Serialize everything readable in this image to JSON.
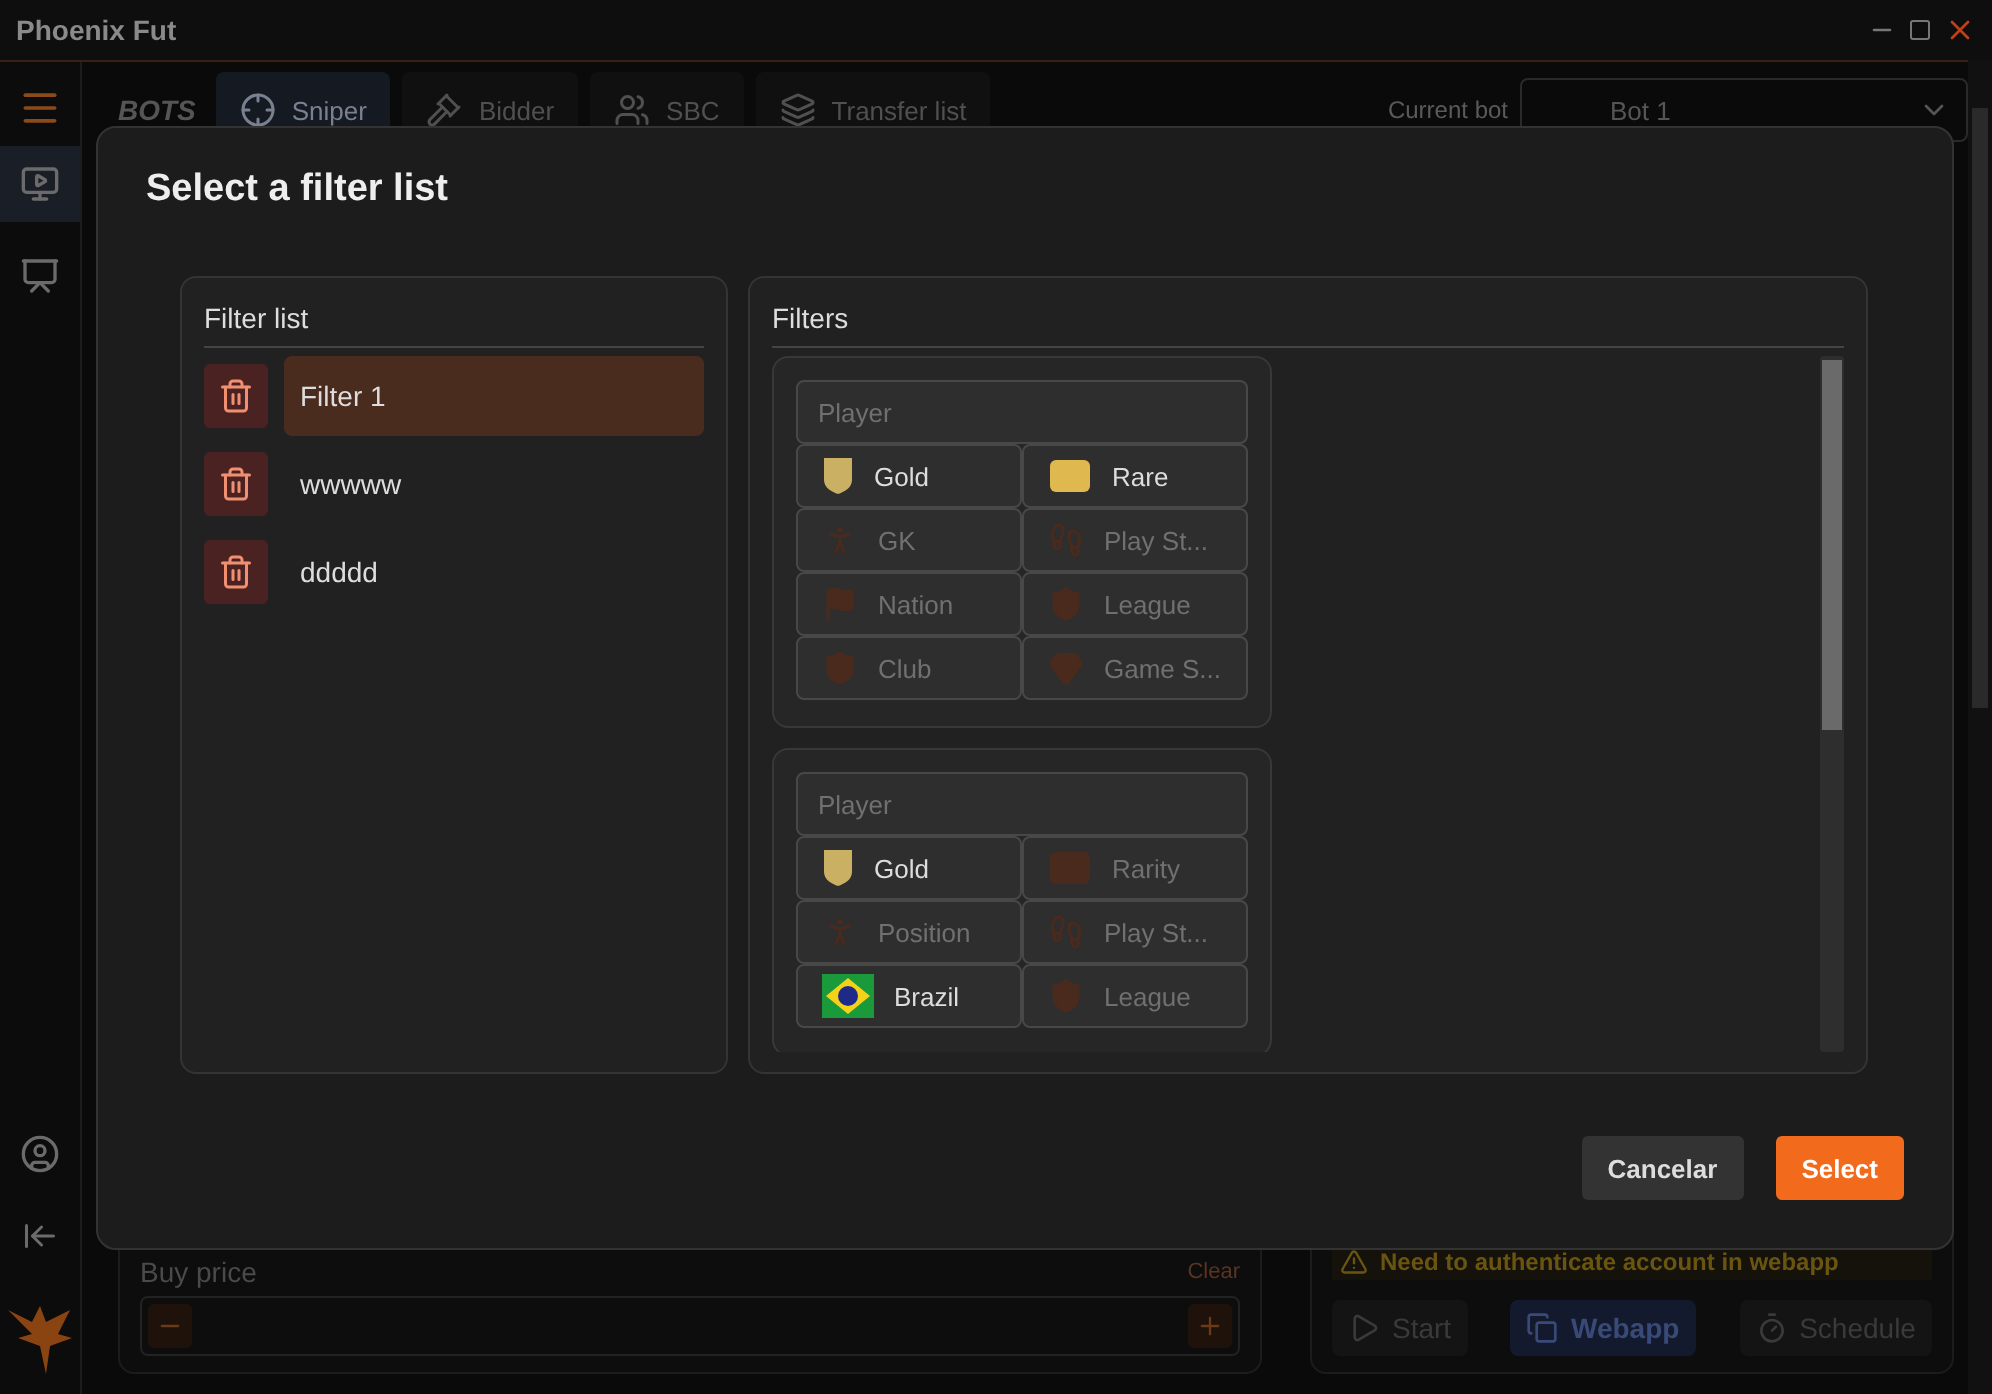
{
  "window": {
    "title": "Phoenix Fut"
  },
  "sidebar": {
    "items": [
      {
        "kind": "bots",
        "selected": true
      },
      {
        "kind": "accounts",
        "selected": false
      }
    ]
  },
  "toolbar": {
    "logo": "BOTS",
    "tabs": [
      {
        "label": "Sniper",
        "kind": "sniper",
        "selected": true
      },
      {
        "label": "Bidder",
        "kind": "bidder",
        "selected": false
      },
      {
        "label": "SBC",
        "kind": "sbc",
        "selected": false
      },
      {
        "label": "Transfer list",
        "kind": "transfer",
        "selected": false
      }
    ],
    "current_bot_label": "Current bot",
    "current_bot": "Bot 1"
  },
  "buy_price": {
    "label": "Buy price",
    "clear": "Clear"
  },
  "webapp_panel": {
    "warning": "Need to authenticate account in webapp",
    "buttons": [
      {
        "label": "Start",
        "kind": "start",
        "selected": false
      },
      {
        "label": "Webapp",
        "kind": "webapp",
        "selected": true
      },
      {
        "label": "Schedule",
        "kind": "schedule",
        "selected": false
      }
    ]
  },
  "dialog": {
    "title": "Select a filter list",
    "filter_list": {
      "heading": "Filter list",
      "items": [
        {
          "name": "Filter 1",
          "selected": true
        },
        {
          "name": "wwwww",
          "selected": false
        },
        {
          "name": "ddddd",
          "selected": false
        }
      ]
    },
    "filters": {
      "heading": "Filters",
      "cards": [
        {
          "placeholder": "Player",
          "cells": [
            {
              "label": "Gold",
              "kind": "quality",
              "active": true
            },
            {
              "label": "Rare",
              "kind": "rarity",
              "active": true
            },
            {
              "label": "GK",
              "kind": "position",
              "active": false
            },
            {
              "label": "Play St...",
              "kind": "playstyle",
              "active": false
            },
            {
              "label": "Nation",
              "kind": "nation",
              "active": false
            },
            {
              "label": "League",
              "kind": "league",
              "active": false
            },
            {
              "label": "Club",
              "kind": "club",
              "active": false
            },
            {
              "label": "Game S...",
              "kind": "gamestyle",
              "active": false
            }
          ]
        },
        {
          "placeholder": "Player",
          "cells": [
            {
              "label": "Gold",
              "kind": "quality",
              "active": true
            },
            {
              "label": "Rarity",
              "kind": "rarity",
              "active": false
            },
            {
              "label": "Position",
              "kind": "position",
              "active": false
            },
            {
              "label": "Play St...",
              "kind": "playstyle",
              "active": false
            },
            {
              "label": "Brazil",
              "kind": "nation",
              "active": true
            },
            {
              "label": "League",
              "kind": "league",
              "active": false
            }
          ]
        }
      ]
    },
    "buttons": [
      {
        "label": "Cancelar",
        "kind": "secondary"
      },
      {
        "label": "Select",
        "kind": "primary"
      }
    ]
  }
}
